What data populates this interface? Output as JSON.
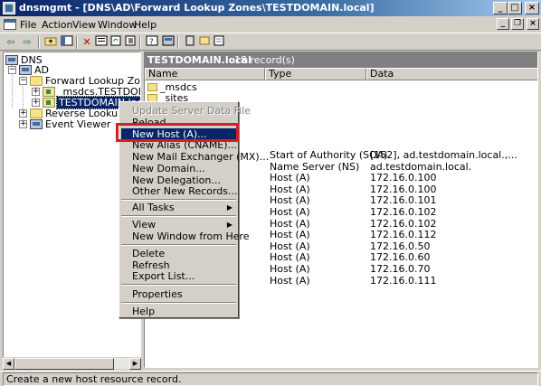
{
  "window": {
    "title": "dnsmgmt - [DNS\\AD\\Forward Lookup Zones\\TESTDOMAIN.local]",
    "minimize": "_",
    "maximize": "□",
    "close": "×"
  },
  "menubar": {
    "items": [
      {
        "label": "File"
      },
      {
        "label": "Action"
      },
      {
        "label": "View"
      },
      {
        "label": "Window"
      },
      {
        "label": "Help"
      }
    ],
    "mdi_minimize": "_",
    "mdi_restore": "❐",
    "mdi_close": "×"
  },
  "toolbar": {
    "icons": [
      "back-icon",
      "forward-icon",
      "up-folder-icon",
      "show-tree-icon",
      "delete-icon",
      "properties-icon",
      "refresh-icon",
      "export-list-icon",
      "help-icon",
      "dns-server-icon",
      "new-record-icon",
      "new-domain-icon",
      "new-delegation-icon"
    ]
  },
  "tree": {
    "root": "DNS",
    "server": "AD",
    "forward_zones": "Forward Lookup Zones",
    "msdcs": "_msdcs.TESTDOMAIN.loc",
    "testdomain": "TESTDOMAIN.local",
    "reverse_zones": "Reverse Lookup Zones",
    "event_viewer": "Event Viewer"
  },
  "details": {
    "zone_title": "TESTDOMAIN.local",
    "record_count": "18 record(s)",
    "columns": [
      "Name",
      "Type",
      "Data"
    ],
    "folders": [
      "_msdcs",
      "_sites"
    ],
    "records": [
      {
        "type": "Start of Authority (SOA)",
        "data": "[152], ad.testdomain.local.,..."
      },
      {
        "type": "Name Server (NS)",
        "data": "ad.testdomain.local."
      },
      {
        "type": "Host (A)",
        "data": "172.16.0.100"
      },
      {
        "type": "Host (A)",
        "data": "172.16.0.100"
      },
      {
        "type": "Host (A)",
        "data": "172.16.0.101"
      },
      {
        "type": "Host (A)",
        "data": "172.16.0.102"
      },
      {
        "type": "Host (A)",
        "data": "172.16.0.102"
      },
      {
        "type": "Host (A)",
        "data": "172.16.0.112"
      },
      {
        "type": "Host (A)",
        "data": "172.16.0.50"
      },
      {
        "type": "Host (A)",
        "data": "172.16.0.60"
      },
      {
        "type": "Host (A)",
        "data": "172.16.0.70"
      },
      {
        "type": "Host (A)",
        "data": "172.16.0.111"
      }
    ]
  },
  "context_menu": {
    "update_server_data_file": "Update Server Data File",
    "reload": "Reload",
    "new_host": "New Host (A)...",
    "new_alias": "New Alias (CNAME)...",
    "new_mail_exchanger": "New Mail Exchanger (MX)...",
    "new_domain": "New Domain...",
    "new_delegation": "New Delegation...",
    "other_new_records": "Other New Records...",
    "all_tasks": "All Tasks",
    "view": "View",
    "new_window": "New Window from Here",
    "delete": "Delete",
    "refresh": "Refresh",
    "export_list": "Export List...",
    "properties": "Properties",
    "help": "Help",
    "submenu_arrow": "▶"
  },
  "statusbar": {
    "text": "Create a new host resource record."
  },
  "colors": {
    "highlight_box": "#d21f1f",
    "selection": "#0a246a",
    "title_gradient_start": "#0a246a"
  }
}
